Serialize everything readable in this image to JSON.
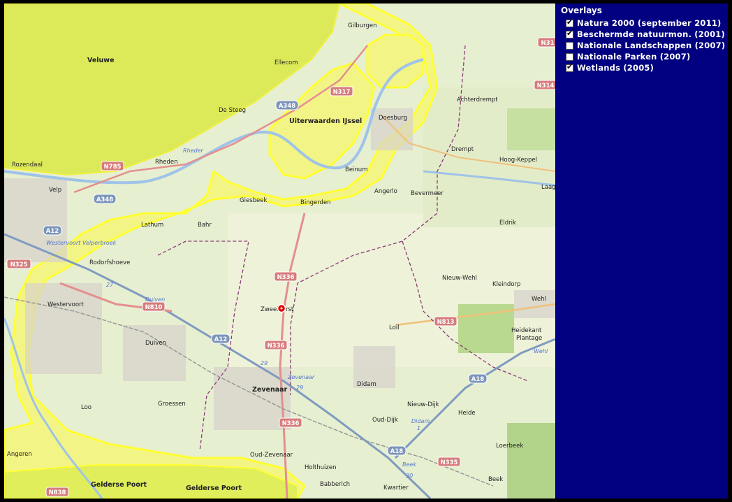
{
  "overlays": {
    "title": "Overlays",
    "items": [
      {
        "label": "Natura 2000 (september 2011)",
        "checked": true
      },
      {
        "label": "Beschermde natuurmon. (2001)",
        "checked": true
      },
      {
        "label": "Nationale Landschappen (2007)",
        "checked": false
      },
      {
        "label": "Nationale Parken (2007)",
        "checked": false
      },
      {
        "label": "Wetlands (2005)",
        "checked": true
      }
    ]
  },
  "map": {
    "marker": {
      "type": "red-dot-marker",
      "color": "#e00000"
    },
    "colors": {
      "natura": "#dfee5a",
      "wetland": "#f5f78a",
      "outline": "#ffff33",
      "land": "#e6efd0"
    },
    "labels": {
      "veluwe": "Veluwe",
      "uiterwaarden": "Uiterwaarden IJssel",
      "gelderse_poort_1": "Gelderse Poort",
      "gelderse_poort_2": "Gelderse Poort",
      "gilburgen": "Gilburgen",
      "ellecom": "Ellecom",
      "de_steeg": "De Steeg",
      "doesburg": "Doesburg",
      "achterdrempt": "Achterdrempt",
      "drempt": "Drempt",
      "hoog_keppel": "Hoog-Keppel",
      "laag": "Laag",
      "rozendaal": "Rozendaal",
      "rheden": "Rheden",
      "velp": "Velp",
      "beinum": "Beinum",
      "angerlo": "Angerlo",
      "bevermeer": "Bevermeer",
      "giesbeek": "Giesbeek",
      "bingerden": "Bingerden",
      "lathum": "Lathum",
      "bahr": "Bahr",
      "eldrik": "Eldrik",
      "rodorfshoeve": "Rodorfshoeve",
      "westervoort": "Westervoort",
      "nieuw_wehl": "Nieuw-Wehl",
      "kleindorp": "Kleindorp",
      "wehl": "Wehl",
      "zweeloorst": "Zweeloorst",
      "loil": "Loil",
      "duiven": "Duiven",
      "heidekant": "Heidekant",
      "plantage": "Plantage",
      "didam": "Didam",
      "zevenaar": "Zevenaar",
      "groessen": "Groessen",
      "loo": "Loo",
      "nieuw_dijk": "Nieuw-Dijk",
      "heide": "Heide",
      "oud_dijk": "Oud-Dijk",
      "angeren": "Angeren",
      "oud_zevenaar": "Oud-Zevenaar",
      "loerbeek": "Loerbeek",
      "holthuizen": "Holthuizen",
      "babberich": "Babberich",
      "kwartier": "Kwartier",
      "beek": "Beek",
      "rhederlaag": "Rheder",
      "velperbroek": "Velperbroek",
      "westervoort_junction": "Westervoort",
      "duiven_river": "Duiven",
      "zevenaar_junction": "Zevenaar",
      "didam_junction": "Didam",
      "beek_junction": "Beek",
      "wehl_junction": "Wehl"
    },
    "shields": {
      "n317": "N317",
      "a348_1": "A348",
      "a348_2": "A348",
      "n785": "N785",
      "a12_1": "A12",
      "a12_2": "A12",
      "n325": "N325",
      "n336_1": "N336",
      "n336_2": "N336",
      "n336_3": "N336",
      "n810": "N810",
      "n813": "N813",
      "a18_1": "A18",
      "a18_2": "A18",
      "n335": "N335",
      "n838": "N838",
      "n31x": "N31",
      "n314": "N314"
    },
    "exit_numbers": {
      "e27": "27",
      "e29": "29",
      "e29b": "29",
      "e30": "30",
      "e1": "1"
    }
  }
}
